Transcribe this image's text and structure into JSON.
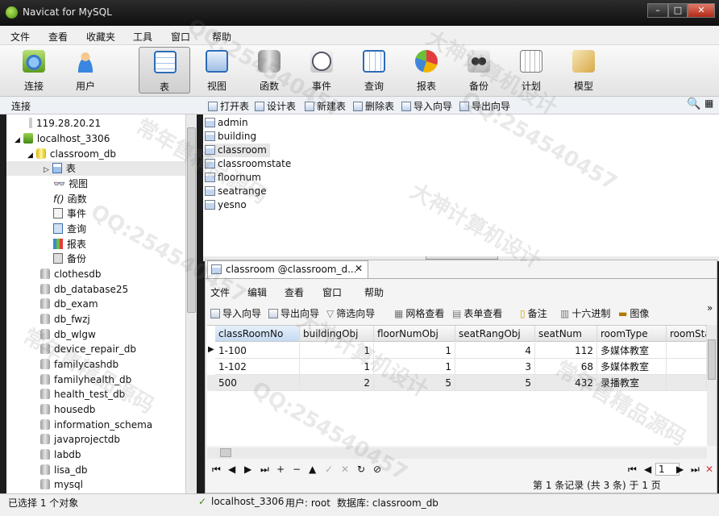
{
  "window": {
    "title": "Navicat for MySQL"
  },
  "menu": [
    "文件",
    "查看",
    "收藏夹",
    "工具",
    "窗口",
    "帮助"
  ],
  "toolbar": [
    {
      "label": "连接",
      "icon": "connection-icon"
    },
    {
      "label": "用户",
      "icon": "user-icon"
    },
    {
      "label": "表",
      "icon": "table-icon",
      "selected": true
    },
    {
      "label": "视图",
      "icon": "view-icon"
    },
    {
      "label": "函数",
      "icon": "function-icon"
    },
    {
      "label": "事件",
      "icon": "event-icon"
    },
    {
      "label": "查询",
      "icon": "query-icon"
    },
    {
      "label": "报表",
      "icon": "report-icon"
    },
    {
      "label": "备份",
      "icon": "backup-icon"
    },
    {
      "label": "计划",
      "icon": "schedule-icon"
    },
    {
      "label": "模型",
      "icon": "model-icon"
    }
  ],
  "connection_header": "连接",
  "object_bar": [
    "打开表",
    "设计表",
    "新建表",
    "删除表",
    "导入向导",
    "导出向导"
  ],
  "tree": [
    {
      "label": "119.28.20.21",
      "type": "server"
    },
    {
      "label": "localhost_3306",
      "type": "server-open"
    },
    {
      "label": "classroom_db",
      "type": "db-open"
    },
    {
      "label": "表",
      "type": "folder-tables"
    },
    {
      "label": "视图",
      "type": "folder-views"
    },
    {
      "label": "函数",
      "type": "folder-functions"
    },
    {
      "label": "事件",
      "type": "folder-events"
    },
    {
      "label": "查询",
      "type": "folder-queries"
    },
    {
      "label": "报表",
      "type": "folder-reports"
    },
    {
      "label": "备份",
      "type": "folder-backups"
    },
    {
      "label": "clothesdb",
      "type": "db"
    },
    {
      "label": "db_database25",
      "type": "db"
    },
    {
      "label": "db_exam",
      "type": "db"
    },
    {
      "label": "db_fwzj",
      "type": "db"
    },
    {
      "label": "db_wlgw",
      "type": "db"
    },
    {
      "label": "device_repair_db",
      "type": "db"
    },
    {
      "label": "familycashdb",
      "type": "db"
    },
    {
      "label": "familyhealth_db",
      "type": "db"
    },
    {
      "label": "health_test_db",
      "type": "db"
    },
    {
      "label": "housedb",
      "type": "db"
    },
    {
      "label": "information_schema",
      "type": "db"
    },
    {
      "label": "javaprojectdb",
      "type": "db"
    },
    {
      "label": "labdb",
      "type": "db"
    },
    {
      "label": "lisa_db",
      "type": "db"
    },
    {
      "label": "mysql",
      "type": "db"
    }
  ],
  "tables": [
    "admin",
    "building",
    "classroom",
    "classroomstate",
    "floornum",
    "seatrange",
    "yesno"
  ],
  "selected_table": "classroom",
  "doc": {
    "tab_title": "classroom @classroom_d...",
    "close": "✕",
    "menu": [
      "文件",
      "编辑",
      "查看",
      "窗口",
      "帮助"
    ],
    "toolbar": [
      "导入向导",
      "导出向导",
      "筛选向导",
      "网格查看",
      "表单查看",
      "备注",
      "十六进制",
      "图像"
    ],
    "more": "»",
    "columns": [
      "classRoomNo",
      "buildingObj",
      "floorNumObj",
      "seatRangObj",
      "seatNum",
      "roomType",
      "roomSta"
    ],
    "rows": [
      [
        "1-100",
        "1",
        "1",
        "4",
        "112",
        "多媒体教室"
      ],
      [
        "1-102",
        "1",
        "1",
        "3",
        "68",
        "多媒体教室"
      ],
      [
        "500",
        "2",
        "5",
        "5",
        "432",
        "录播教室"
      ]
    ],
    "nav_buttons": [
      "⏮",
      "◀",
      "▶",
      "⏭",
      "+",
      "−",
      "▲",
      "✓",
      "✕",
      "↻",
      "⊘"
    ],
    "page_input": "1",
    "record_info": "第 1 条记录 (共 3 条) 于 1 页"
  },
  "status": {
    "left": "已选择 1 个对象",
    "connection": "localhost_3306",
    "user": "用户: root",
    "database": "数据库: classroom_db"
  },
  "watermarks": [
    "常年售精品源码",
    "QQ:254540457",
    "大神计算机设计"
  ]
}
